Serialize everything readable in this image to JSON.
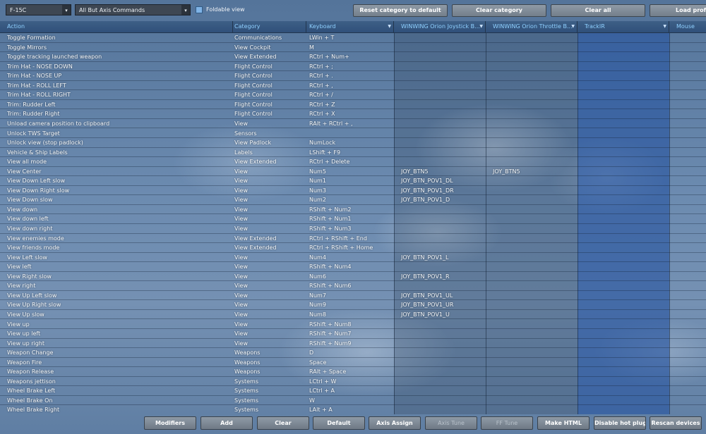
{
  "toolbar": {
    "aircraft_select": "F-15C",
    "filter_select": "All But Axis Commands",
    "foldable_label": "Foldable view",
    "reset_category_label": "Reset category to default",
    "clear_category_label": "Clear category",
    "clear_all_label": "Clear all",
    "load_profile_label": "Load profi"
  },
  "columns": {
    "action": "Action",
    "category": "Category",
    "keyboard": "Keyboard",
    "joystick": "WINWING Orion Joystick B...",
    "throttle": "WINWING Orion Throttle B...",
    "trackir": "TrackIR",
    "mouse": "Mouse"
  },
  "rows": [
    {
      "action": "Toggle Formation",
      "category": "Communications",
      "keyboard": "LWin + T",
      "joystick": "",
      "throttle": ""
    },
    {
      "action": "Toggle Mirrors",
      "category": "View Cockpit",
      "keyboard": "M",
      "joystick": "",
      "throttle": ""
    },
    {
      "action": "Toggle tracking launched weapon",
      "category": "View Extended",
      "keyboard": "RCtrl + Num+",
      "joystick": "",
      "throttle": ""
    },
    {
      "action": "Trim Hat - NOSE DOWN",
      "category": "Flight Control",
      "keyboard": "RCtrl + ;",
      "joystick": "",
      "throttle": ""
    },
    {
      "action": "Trim Hat - NOSE UP",
      "category": "Flight Control",
      "keyboard": "RCtrl + .",
      "joystick": "",
      "throttle": ""
    },
    {
      "action": "Trim Hat - ROLL LEFT",
      "category": "Flight Control",
      "keyboard": "RCtrl + ,",
      "joystick": "",
      "throttle": ""
    },
    {
      "action": "Trim Hat - ROLL RIGHT",
      "category": "Flight Control",
      "keyboard": "RCtrl + /",
      "joystick": "",
      "throttle": ""
    },
    {
      "action": "Trim: Rudder Left",
      "category": "Flight Control",
      "keyboard": "RCtrl + Z",
      "joystick": "",
      "throttle": ""
    },
    {
      "action": "Trim: Rudder Right",
      "category": "Flight Control",
      "keyboard": "RCtrl + X",
      "joystick": "",
      "throttle": ""
    },
    {
      "action": "Unload camera position to clipboard",
      "category": "View",
      "keyboard": "RAlt + RCtrl + ,",
      "joystick": "",
      "throttle": ""
    },
    {
      "action": "Unlock TWS Target",
      "category": "Sensors",
      "keyboard": "",
      "joystick": "",
      "throttle": ""
    },
    {
      "action": "Unlock view (stop padlock)",
      "category": "View Padlock",
      "keyboard": "NumLock",
      "joystick": "",
      "throttle": ""
    },
    {
      "action": "Vehicle & Ship Labels",
      "category": "Labels",
      "keyboard": "LShift + F9",
      "joystick": "",
      "throttle": ""
    },
    {
      "action": "View all mode",
      "category": "View Extended",
      "keyboard": "RCtrl + Delete",
      "joystick": "",
      "throttle": ""
    },
    {
      "action": "View Center",
      "category": "View",
      "keyboard": "Num5",
      "joystick": "JOY_BTN5",
      "throttle": "JOY_BTN5"
    },
    {
      "action": "View Down Left slow",
      "category": "View",
      "keyboard": "Num1",
      "joystick": "JOY_BTN_POV1_DL",
      "throttle": ""
    },
    {
      "action": "View Down Right slow",
      "category": "View",
      "keyboard": "Num3",
      "joystick": "JOY_BTN_POV1_DR",
      "throttle": ""
    },
    {
      "action": "View Down slow",
      "category": "View",
      "keyboard": "Num2",
      "joystick": "JOY_BTN_POV1_D",
      "throttle": ""
    },
    {
      "action": "View down",
      "category": "View",
      "keyboard": "RShift + Num2",
      "joystick": "",
      "throttle": ""
    },
    {
      "action": "View down left",
      "category": "View",
      "keyboard": "RShift + Num1",
      "joystick": "",
      "throttle": ""
    },
    {
      "action": "View down right",
      "category": "View",
      "keyboard": "RShift + Num3",
      "joystick": "",
      "throttle": ""
    },
    {
      "action": "View enemies mode",
      "category": "View Extended",
      "keyboard": "RCtrl + RShift + End",
      "joystick": "",
      "throttle": ""
    },
    {
      "action": "View friends mode",
      "category": "View Extended",
      "keyboard": "RCtrl + RShift + Home",
      "joystick": "",
      "throttle": ""
    },
    {
      "action": "View Left slow",
      "category": "View",
      "keyboard": "Num4",
      "joystick": "JOY_BTN_POV1_L",
      "throttle": ""
    },
    {
      "action": "View left",
      "category": "View",
      "keyboard": "RShift + Num4",
      "joystick": "",
      "throttle": ""
    },
    {
      "action": "View Right slow",
      "category": "View",
      "keyboard": "Num6",
      "joystick": "JOY_BTN_POV1_R",
      "throttle": ""
    },
    {
      "action": "View right",
      "category": "View",
      "keyboard": "RShift + Num6",
      "joystick": "",
      "throttle": ""
    },
    {
      "action": "View Up Left slow",
      "category": "View",
      "keyboard": "Num7",
      "joystick": "JOY_BTN_POV1_UL",
      "throttle": ""
    },
    {
      "action": "View Up Right slow",
      "category": "View",
      "keyboard": "Num9",
      "joystick": "JOY_BTN_POV1_UR",
      "throttle": ""
    },
    {
      "action": "View Up slow",
      "category": "View",
      "keyboard": "Num8",
      "joystick": "JOY_BTN_POV1_U",
      "throttle": ""
    },
    {
      "action": "View up",
      "category": "View",
      "keyboard": "RShift + Num8",
      "joystick": "",
      "throttle": ""
    },
    {
      "action": "View up left",
      "category": "View",
      "keyboard": "RShift + Num7",
      "joystick": "",
      "throttle": ""
    },
    {
      "action": "View up right",
      "category": "View",
      "keyboard": "RShift + Num9",
      "joystick": "",
      "throttle": ""
    },
    {
      "action": "Weapon Change",
      "category": "Weapons",
      "keyboard": "D",
      "joystick": "",
      "throttle": ""
    },
    {
      "action": "Weapon Fire",
      "category": "Weapons",
      "keyboard": "Space",
      "joystick": "",
      "throttle": ""
    },
    {
      "action": "Weapon Release",
      "category": "Weapons",
      "keyboard": "RAlt + Space",
      "joystick": "",
      "throttle": ""
    },
    {
      "action": "Weapons jettison",
      "category": "Systems",
      "keyboard": "LCtrl + W",
      "joystick": "",
      "throttle": ""
    },
    {
      "action": "Wheel Brake Left",
      "category": "Systems",
      "keyboard": "LCtrl + A",
      "joystick": "",
      "throttle": ""
    },
    {
      "action": "Wheel Brake On",
      "category": "Systems",
      "keyboard": "W",
      "joystick": "",
      "throttle": ""
    },
    {
      "action": "Wheel Brake Right",
      "category": "Systems",
      "keyboard": "LAlt + A",
      "joystick": "",
      "throttle": ""
    }
  ],
  "bottom_buttons": {
    "modifiers": "Modifiers",
    "add": "Add",
    "clear": "Clear",
    "default": "Default",
    "axis_assign": "Axis Assign",
    "axis_tune": "Axis Tune",
    "ff_tune": "FF Tune",
    "make_html": "Make HTML",
    "disable_hot_plug": "Disable hot plug",
    "rescan_devices": "Rescan devices"
  },
  "colors": {
    "header_text": "#8fd0ff",
    "trackir_column": "#3f6aa8",
    "button_face": "#8f9aa6"
  }
}
